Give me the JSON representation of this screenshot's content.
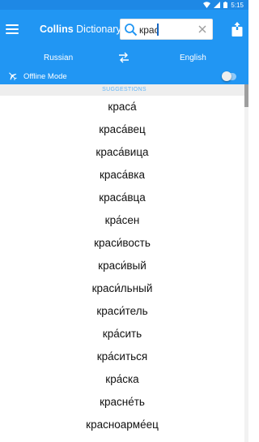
{
  "status_bar": {
    "time": "5:15",
    "icons": [
      "wifi-icon",
      "signal-icon",
      "battery-icon"
    ]
  },
  "toolbar": {
    "title_bold": "Collins",
    "title_rest": " Dictionary",
    "search_value": "крас",
    "icons": [
      "menu-icon",
      "search-icon",
      "clear-icon",
      "share-icon"
    ]
  },
  "language": {
    "from": "Russian",
    "to": "English"
  },
  "offline": {
    "label": "Offline Mode",
    "enabled": false
  },
  "suggestions": {
    "header": "SUGGESTIONS",
    "items": [
      "краса́",
      "краса́вец",
      "краса́вица",
      "краса́вка",
      "краса́вца",
      "кра́сен",
      "краси́вость",
      "краси́вый",
      "краси́льный",
      "краси́тель",
      "кра́сить",
      "кра́ситься",
      "кра́ска",
      "красне́ть",
      "красноарме́ец"
    ]
  },
  "colors": {
    "primary": "#2196f3",
    "status": "#1e88e5",
    "accent_text": "#64b5f6"
  }
}
